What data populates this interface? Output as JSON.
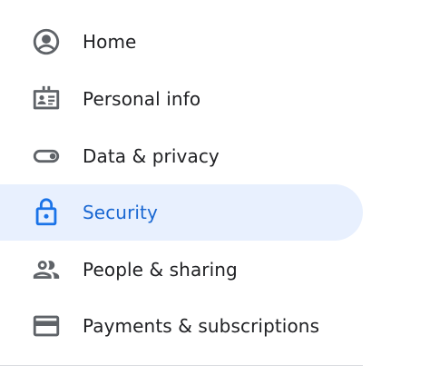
{
  "nav": {
    "items": [
      {
        "label": "Home",
        "icon": "account-circle-icon",
        "active": false
      },
      {
        "label": "Personal info",
        "icon": "id-card-icon",
        "active": false
      },
      {
        "label": "Data & privacy",
        "icon": "toggle-icon",
        "active": false
      },
      {
        "label": "Security",
        "icon": "lock-icon",
        "active": true
      },
      {
        "label": "People & sharing",
        "icon": "people-icon",
        "active": false
      },
      {
        "label": "Payments & subscriptions",
        "icon": "credit-card-icon",
        "active": false
      }
    ]
  },
  "colors": {
    "active_bg": "#e8f0fe",
    "active_text": "#1967d2",
    "icon_gray": "#5f6368",
    "text": "#202124",
    "divider": "#dadce0"
  }
}
